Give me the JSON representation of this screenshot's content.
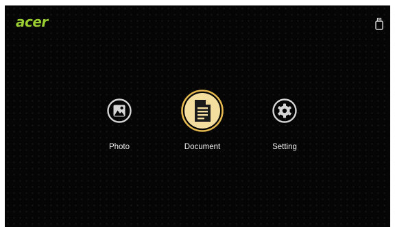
{
  "brand": {
    "logo_text": "acer",
    "logo_color": "#9acd32"
  },
  "status": {
    "usb_icon": "usb-drive-icon"
  },
  "menu": {
    "items": [
      {
        "label": "Photo",
        "icon": "photo-icon",
        "selected": false
      },
      {
        "label": "Document",
        "icon": "document-icon",
        "selected": true
      },
      {
        "label": "Setting",
        "icon": "gear-icon",
        "selected": false
      }
    ]
  },
  "colors": {
    "background": "#050505",
    "icon": "#d6d6d6",
    "label": "#f2f2f2",
    "selected_ring": "#e5b94e",
    "selected_fill": "#f3dea0"
  }
}
